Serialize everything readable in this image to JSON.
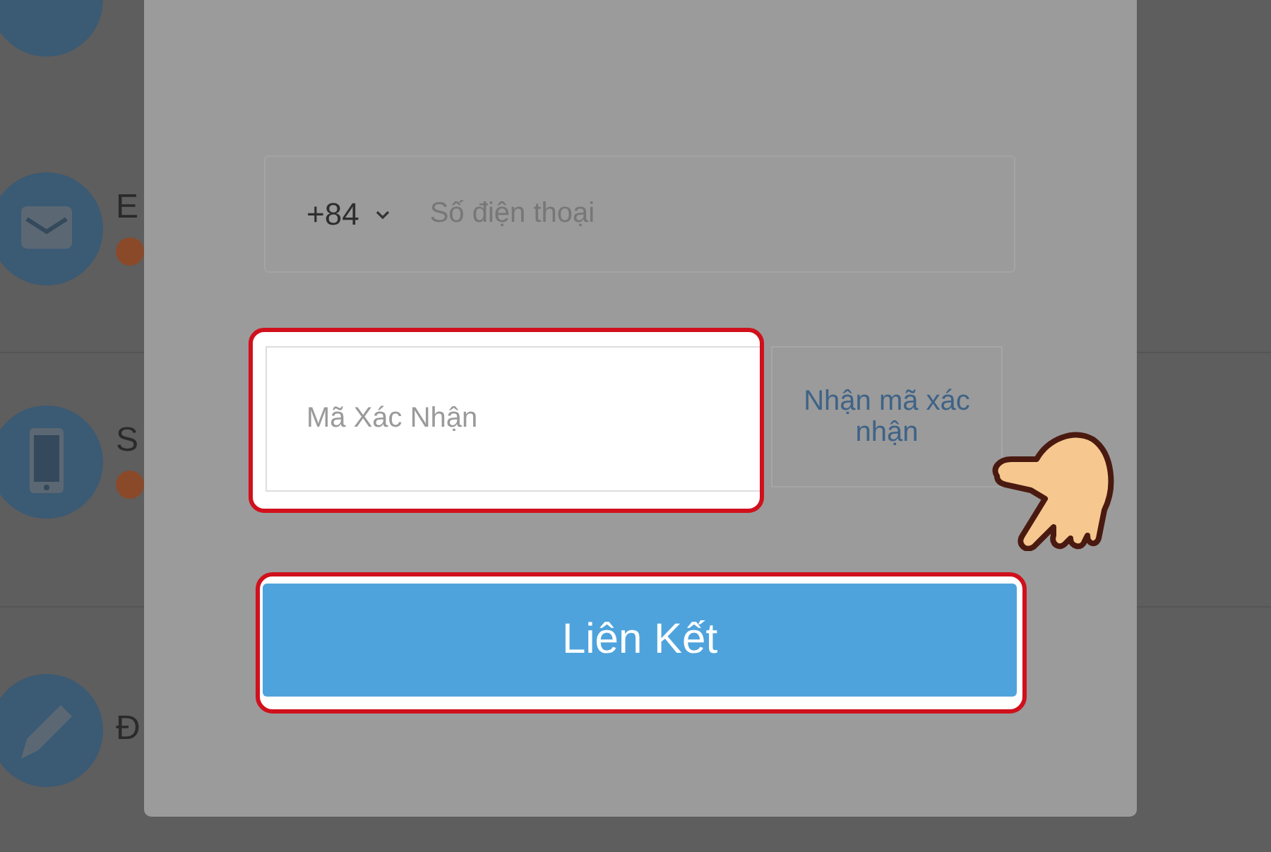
{
  "background_list": {
    "items": [
      {
        "kind": "partial"
      },
      {
        "kind": "mail",
        "label": "E",
        "warning": true
      },
      {
        "kind": "phone",
        "label": "S",
        "warning": true
      },
      {
        "kind": "pencil",
        "label": "Đ",
        "warning": false
      }
    ]
  },
  "dialog": {
    "phone_field": {
      "country_code": "+84",
      "placeholder": "Số điện thoại"
    },
    "code_field": {
      "placeholder": "Mã Xác Nhận",
      "highlighted": true
    },
    "get_code_link": "Nhận mã xác nhận",
    "submit_button": {
      "label": "Liên Kết",
      "highlighted": true
    }
  }
}
